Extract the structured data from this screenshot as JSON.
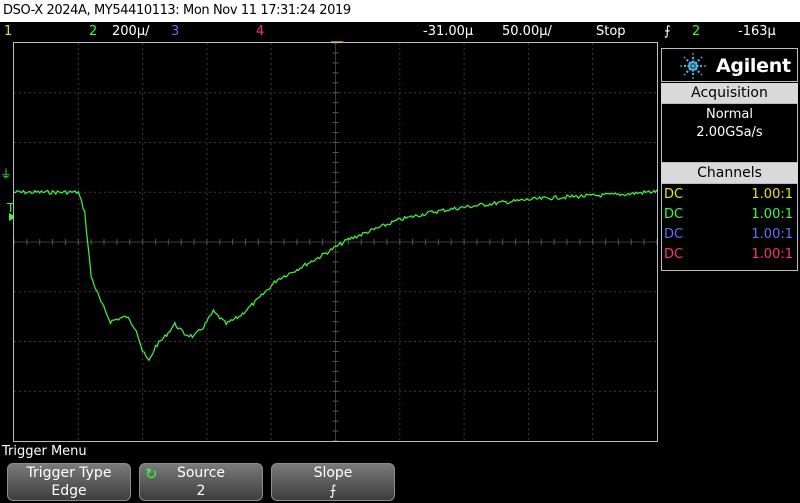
{
  "title_bar": {
    "text": "DSO-X 2024A, MY54410113: Mon Nov 11 17:31:24 2019"
  },
  "status_bar": {
    "ch1_label": "1",
    "ch2_label": "2",
    "ch2_scale": "200µ/",
    "ch3_label": "3",
    "ch4_label": "4",
    "delay": "-31.00µ",
    "timebase": "50.00µ/",
    "run_state": "Stop",
    "trigger_slope_icon": "falling-edge-icon",
    "trigger_slope_symbol": "⨍",
    "trigger_source": "2",
    "trigger_level": "-163µ"
  },
  "left_markers": {
    "ch2_ground": "2",
    "trigger_level": "T"
  },
  "side_panel": {
    "logo_text": "Agilent",
    "acquisition": {
      "header": "Acquisition",
      "mode": "Normal",
      "sample_rate": "2.00GSa/s"
    },
    "channels": {
      "header": "Channels",
      "rows": [
        {
          "coupling": "DC",
          "ratio": "1.00:1",
          "color": "#e6e600"
        },
        {
          "coupling": "DC",
          "ratio": "1.00:1",
          "color": "#33ff33"
        },
        {
          "coupling": "DC",
          "ratio": "1.00:1",
          "color": "#6b6bff"
        },
        {
          "coupling": "DC",
          "ratio": "1.00:1",
          "color": "#ff3080"
        }
      ]
    }
  },
  "menu": {
    "title": "Trigger Menu",
    "softkeys": [
      {
        "label": "Trigger Type",
        "value": "Edge",
        "icon": ""
      },
      {
        "label": "Source",
        "value": "2",
        "icon": "rotate-knob-icon"
      },
      {
        "label": "Slope",
        "value": "⨍",
        "icon": ""
      }
    ]
  },
  "colors": {
    "ch1": "#e6e600",
    "ch2": "#33ff33",
    "ch3": "#6b6bff",
    "ch4": "#ff3080",
    "trace": "#33ff33",
    "trigger_marker": "#ff9900"
  },
  "waveform": {
    "channel": "2",
    "points": [
      [
        0.0,
        1.0
      ],
      [
        0.25,
        1.0
      ],
      [
        0.5,
        1.0
      ],
      [
        0.75,
        1.0
      ],
      [
        1.0,
        1.0
      ],
      [
        1.1,
        0.6
      ],
      [
        1.2,
        -0.7
      ],
      [
        1.35,
        -1.2
      ],
      [
        1.5,
        -1.6
      ],
      [
        1.6,
        -1.55
      ],
      [
        1.75,
        -1.5
      ],
      [
        1.9,
        -1.75
      ],
      [
        2.0,
        -2.2
      ],
      [
        2.1,
        -2.4
      ],
      [
        2.2,
        -2.1
      ],
      [
        2.35,
        -1.9
      ],
      [
        2.5,
        -1.65
      ],
      [
        2.65,
        -1.85
      ],
      [
        2.8,
        -1.9
      ],
      [
        2.95,
        -1.7
      ],
      [
        3.1,
        -1.4
      ],
      [
        3.3,
        -1.65
      ],
      [
        3.5,
        -1.5
      ],
      [
        3.8,
        -1.15
      ],
      [
        4.1,
        -0.75
      ],
      [
        4.4,
        -0.55
      ],
      [
        4.75,
        -0.3
      ],
      [
        5.2,
        0.05
      ],
      [
        5.6,
        0.25
      ],
      [
        6.0,
        0.45
      ],
      [
        6.5,
        0.6
      ],
      [
        7.0,
        0.7
      ],
      [
        7.5,
        0.78
      ],
      [
        8.0,
        0.85
      ],
      [
        8.5,
        0.9
      ],
      [
        9.0,
        0.93
      ],
      [
        9.5,
        0.96
      ],
      [
        10.0,
        1.02
      ]
    ]
  }
}
